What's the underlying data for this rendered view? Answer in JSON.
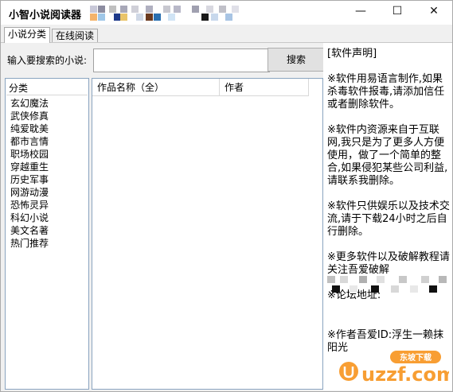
{
  "window": {
    "title": "小智小说阅读器"
  },
  "controls": {
    "minimize": "—",
    "maximize": "☐",
    "close": "✕"
  },
  "tabs": [
    {
      "label": "小说分类",
      "active": true
    },
    {
      "label": "在线阅读",
      "active": false
    }
  ],
  "search": {
    "label": "输入要搜索的小说:",
    "value": "",
    "placeholder": "",
    "button": "搜索"
  },
  "categories": {
    "header": "分类",
    "items": [
      "玄幻魔法",
      "武侠修真",
      "纯爱耽美",
      "都市言情",
      "职场校园",
      "穿越重生",
      "历史军事",
      "网游动漫",
      "恐怖灵异",
      "科幻小说",
      "美文名著",
      "热门推荐"
    ]
  },
  "books": {
    "columns": [
      "作品名称（全）",
      "作者"
    ],
    "rows": []
  },
  "notice": {
    "title": "[软件声明]",
    "p1": "※软件用易语言制作,如果杀毒软件报毒,请添加信任或者删除软件。",
    "p2": "※软件内资源来自于互联网,我只是为了更多人方便使用，做了一个简单的整合,如果侵犯某些公司利益,请联系我删除。",
    "p3": "※软件只供娱乐以及技术交流,请于下载24小时之后自行删除。",
    "p4": "※更多软件以及破解教程请关注吾爱破解",
    "p5": "※论坛地址:",
    "p6": "※作者吾爱ID:浮生一赖抹阳光"
  },
  "watermark": {
    "text": "uzzf.com",
    "badge": "东坡下载"
  },
  "colors": {
    "accent": "#0078d7",
    "border": "#8aa4c0",
    "watermark": "#f7941d"
  }
}
